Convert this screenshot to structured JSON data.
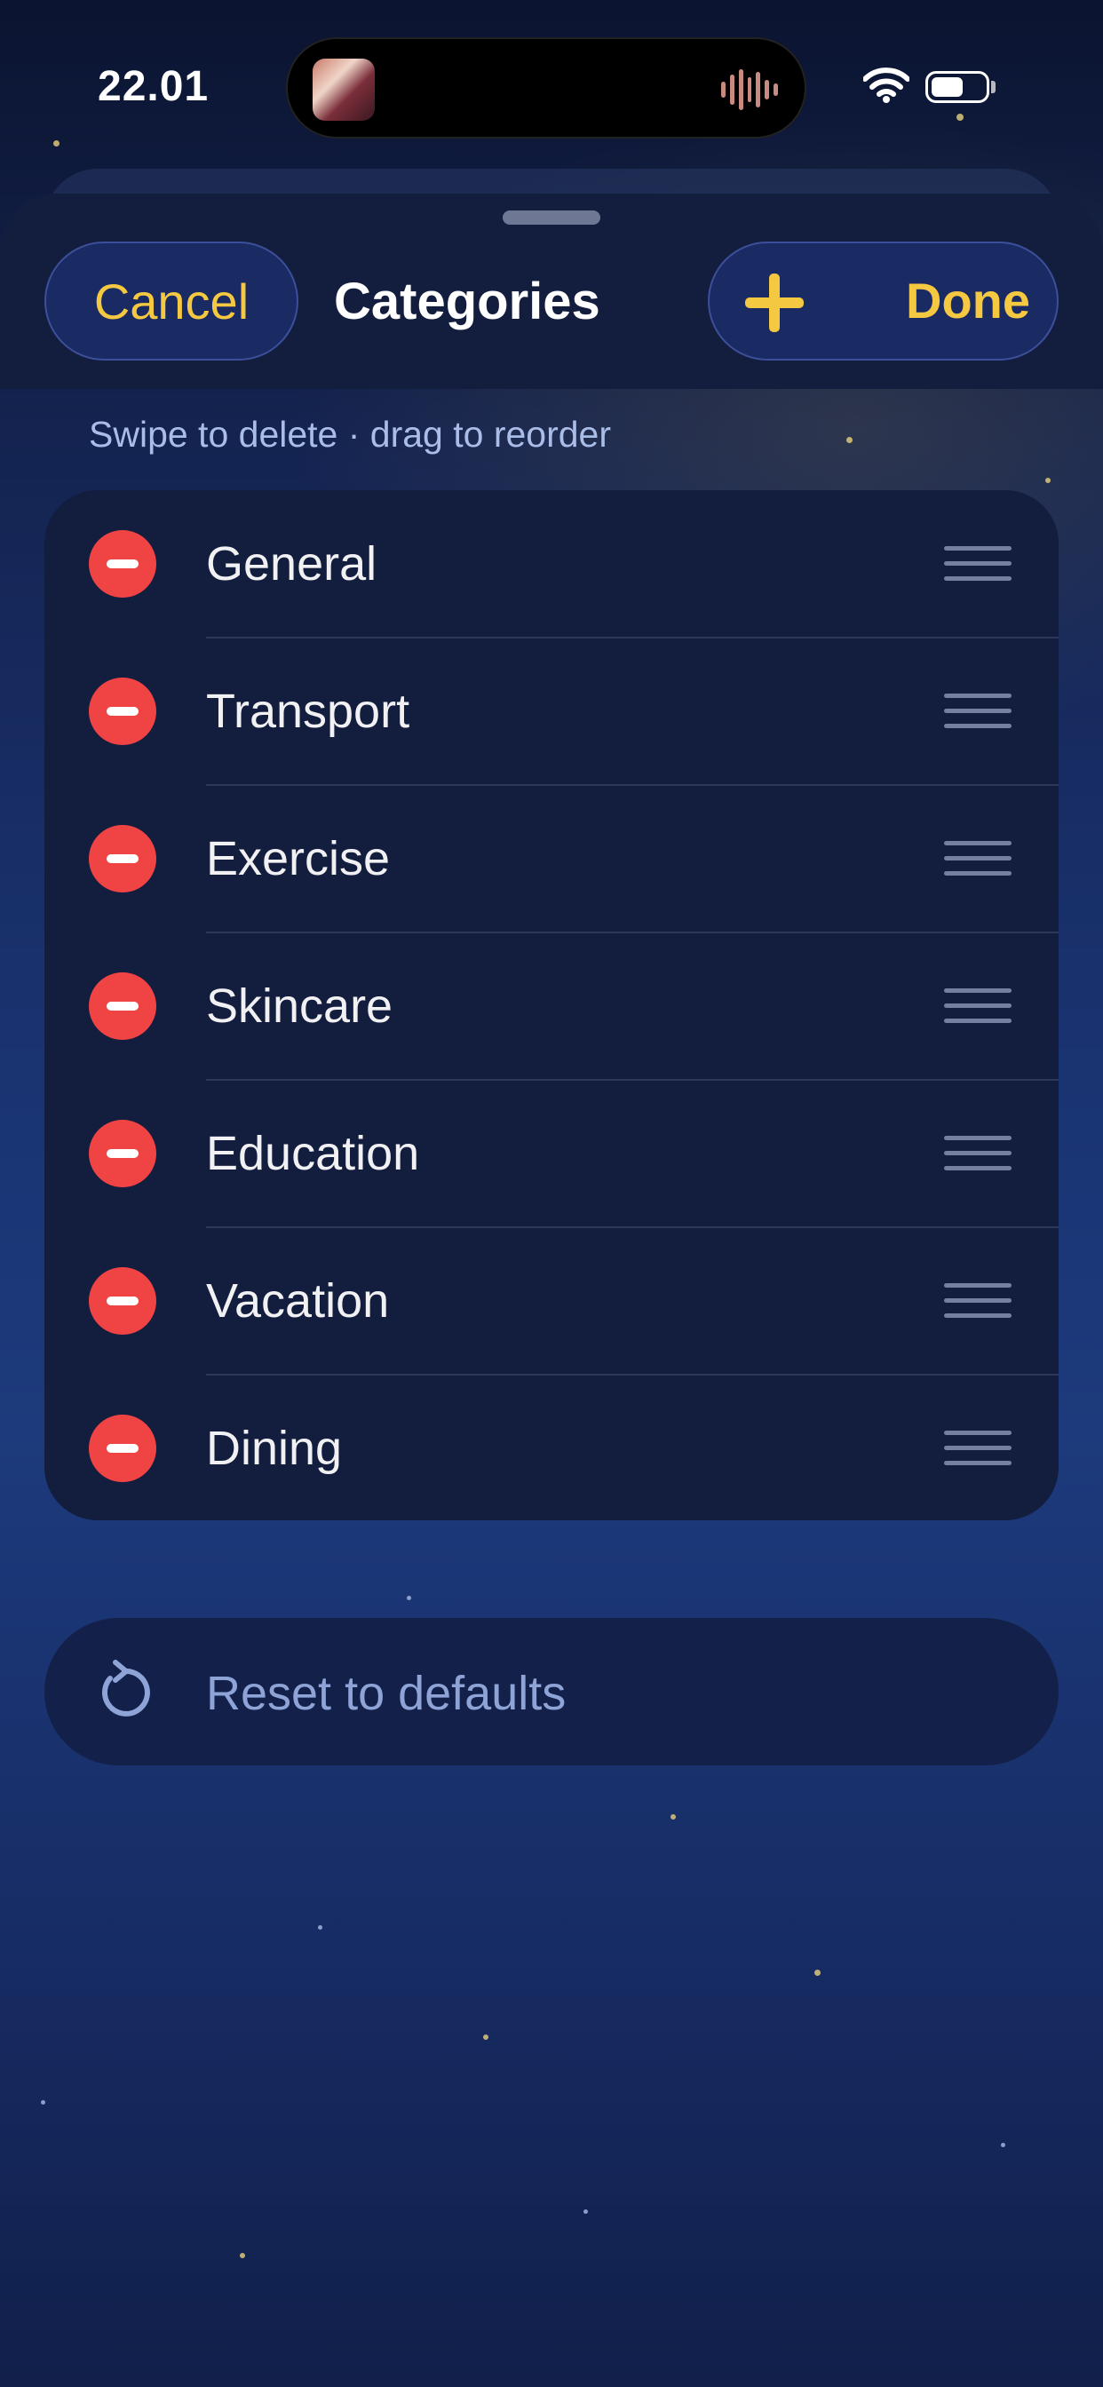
{
  "status_bar": {
    "time": "22.01",
    "battery_level": 0.6
  },
  "header": {
    "cancel_label": "Cancel",
    "title": "Categories",
    "add_icon": "plus-icon",
    "done_label": "Done"
  },
  "hint": "Swipe to delete · drag to reorder",
  "categories": [
    {
      "label": "General"
    },
    {
      "label": "Transport"
    },
    {
      "label": "Exercise"
    },
    {
      "label": "Skincare"
    },
    {
      "label": "Education"
    },
    {
      "label": "Vacation"
    },
    {
      "label": "Dining"
    }
  ],
  "reset": {
    "label": "Reset to defaults",
    "icon": "reset-arrow-icon"
  },
  "colors": {
    "accent": "#f5c842",
    "delete": "#f04444",
    "sheet": "#131d3e"
  }
}
